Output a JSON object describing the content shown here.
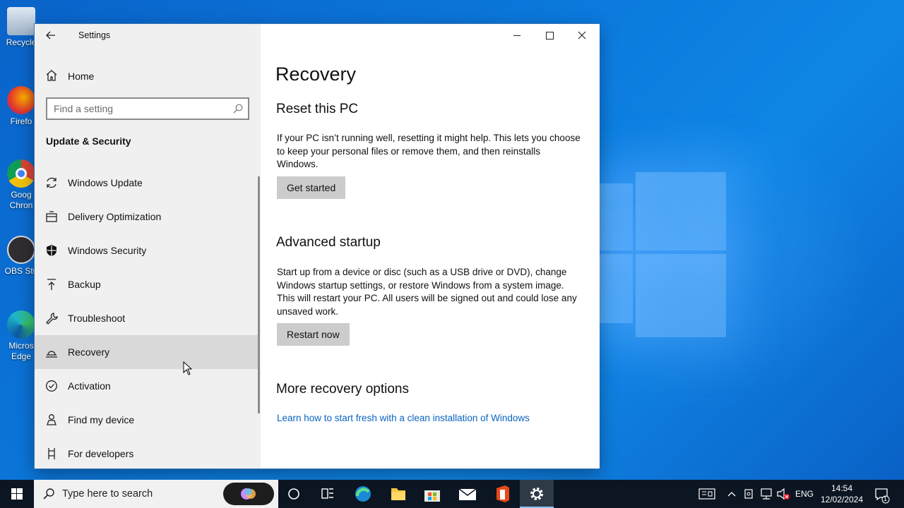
{
  "window": {
    "app_title": "Settings",
    "home_label": "Home",
    "search_placeholder": "Find a setting",
    "section_title": "Update & Security",
    "nav_items": [
      {
        "label": "Windows Update",
        "icon": "sync-icon"
      },
      {
        "label": "Delivery Optimization",
        "icon": "delivery-icon"
      },
      {
        "label": "Windows Security",
        "icon": "shield-icon"
      },
      {
        "label": "Backup",
        "icon": "upload-arrow-icon"
      },
      {
        "label": "Troubleshoot",
        "icon": "wrench-icon"
      },
      {
        "label": "Recovery",
        "icon": "recovery-icon",
        "selected": true
      },
      {
        "label": "Activation",
        "icon": "check-circle-icon"
      },
      {
        "label": "Find my device",
        "icon": "person-location-icon"
      },
      {
        "label": "For developers",
        "icon": "developer-tools-icon"
      }
    ]
  },
  "content": {
    "page_title": "Recovery",
    "reset": {
      "heading": "Reset this PC",
      "description": "If your PC isn’t running well, resetting it might help. This lets you choose to keep your personal files or remove them, and then reinstalls Windows.",
      "button": "Get started"
    },
    "advanced": {
      "heading": "Advanced startup",
      "description": "Start up from a device or disc (such as a USB drive or DVD), change Windows startup settings, or restore Windows from a system image. This will restart your PC. All users will be signed out and could lose any unsaved work.",
      "button": "Restart now"
    },
    "more": {
      "heading": "More recovery options",
      "link": "Learn how to start fresh with a clean installation of Windows"
    }
  },
  "desktop_icons": [
    {
      "label": "Recycle",
      "icon": "recycle-bin-icon"
    },
    {
      "label": "Firefo",
      "icon": "firefox-icon"
    },
    {
      "label": "Goog Chron",
      "icon": "chrome-icon"
    },
    {
      "label": "OBS Stu",
      "icon": "obs-icon"
    },
    {
      "label": "Micros Edge",
      "icon": "edge-icon"
    }
  ],
  "taskbar": {
    "search_placeholder": "Type here to search",
    "language": "ENG",
    "time": "14:54",
    "date": "12/02/2024",
    "notification_count": "1"
  },
  "colors": {
    "desktop": "#0b78dc",
    "accent": "#0a64c0",
    "sidebar": "#f0f0f0",
    "taskbar": "#0c1622"
  }
}
